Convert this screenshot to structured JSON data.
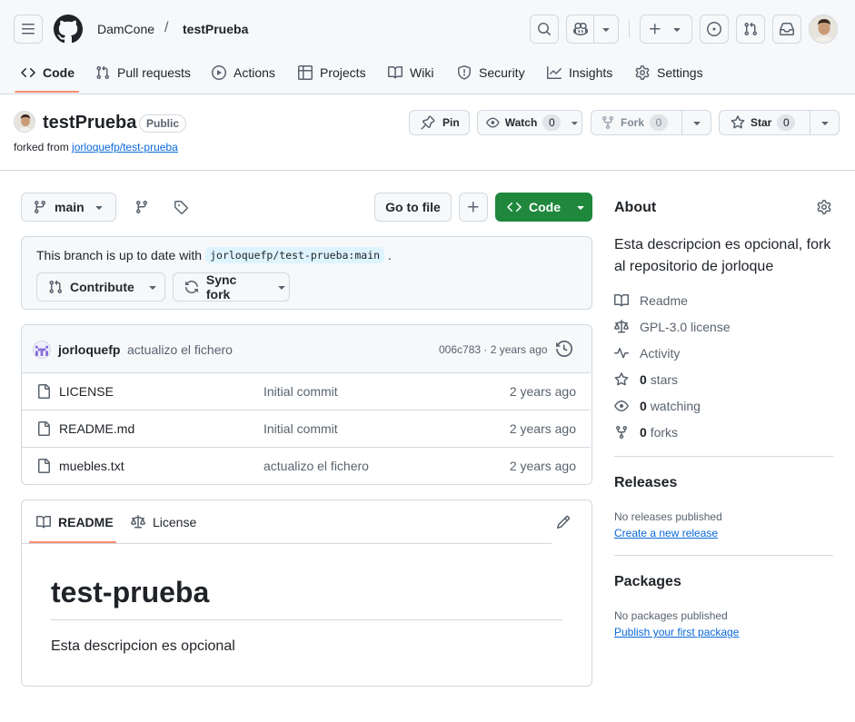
{
  "header": {
    "owner": "DamCone",
    "separator": "/",
    "repo": "testPrueba"
  },
  "nav": {
    "tabs": [
      {
        "label": "Code",
        "icon": "code-icon"
      },
      {
        "label": "Pull requests",
        "icon": "git-pull-request-icon"
      },
      {
        "label": "Actions",
        "icon": "play-icon"
      },
      {
        "label": "Projects",
        "icon": "table-icon"
      },
      {
        "label": "Wiki",
        "icon": "book-icon"
      },
      {
        "label": "Security",
        "icon": "shield-icon"
      },
      {
        "label": "Insights",
        "icon": "graph-icon"
      },
      {
        "label": "Settings",
        "icon": "gear-icon"
      }
    ],
    "active": "Code",
    "accent": "#fd8c73"
  },
  "repo": {
    "name": "testPrueba",
    "visibility": "Public",
    "forked_prefix": "forked from",
    "forked_from": "jorloquefp/test-prueba",
    "pin_label": "Pin",
    "watch_label": "Watch",
    "watch_count": "0",
    "fork_label": "Fork",
    "fork_count": "0",
    "star_label": "Star",
    "star_count": "0"
  },
  "toolbar": {
    "branch": "main",
    "go_to_file": "Go to file",
    "code_label": "Code",
    "code_color": "#1f883d"
  },
  "sync": {
    "text": "This branch is up to date with",
    "ref": "jorloquefp/test-prueba:main",
    "suffix": ".",
    "contribute_label": "Contribute",
    "sync_label": "Sync fork"
  },
  "commit": {
    "author": "jorloquefp",
    "message": "actualizo el fichero",
    "sha_time": "006c783 · 2 years ago"
  },
  "files": [
    {
      "name": "LICENSE",
      "message": "Initial commit",
      "date": "2 years ago"
    },
    {
      "name": "README.md",
      "message": "Initial commit",
      "date": "2 years ago"
    },
    {
      "name": "muebles.txt",
      "message": "actualizo el fichero",
      "date": "2 years ago"
    }
  ],
  "readme": {
    "tab_readme": "README",
    "tab_license": "License",
    "title": "test-prueba",
    "body": "Esta descripcion es opcional"
  },
  "about": {
    "heading": "About",
    "description": "Esta descripcion es opcional, fork al repositorio de jorloque",
    "readme": "Readme",
    "license": "GPL-3.0 license",
    "activity": "Activity",
    "stars_count": "0",
    "stars_label": "stars",
    "watching_count": "0",
    "watching_label": "watching",
    "forks_count": "0",
    "forks_label": "forks"
  },
  "releases": {
    "heading": "Releases",
    "none": "No releases published",
    "link": "Create a new release"
  },
  "packages": {
    "heading": "Packages",
    "none": "No packages published",
    "link": "Publish your first package"
  }
}
